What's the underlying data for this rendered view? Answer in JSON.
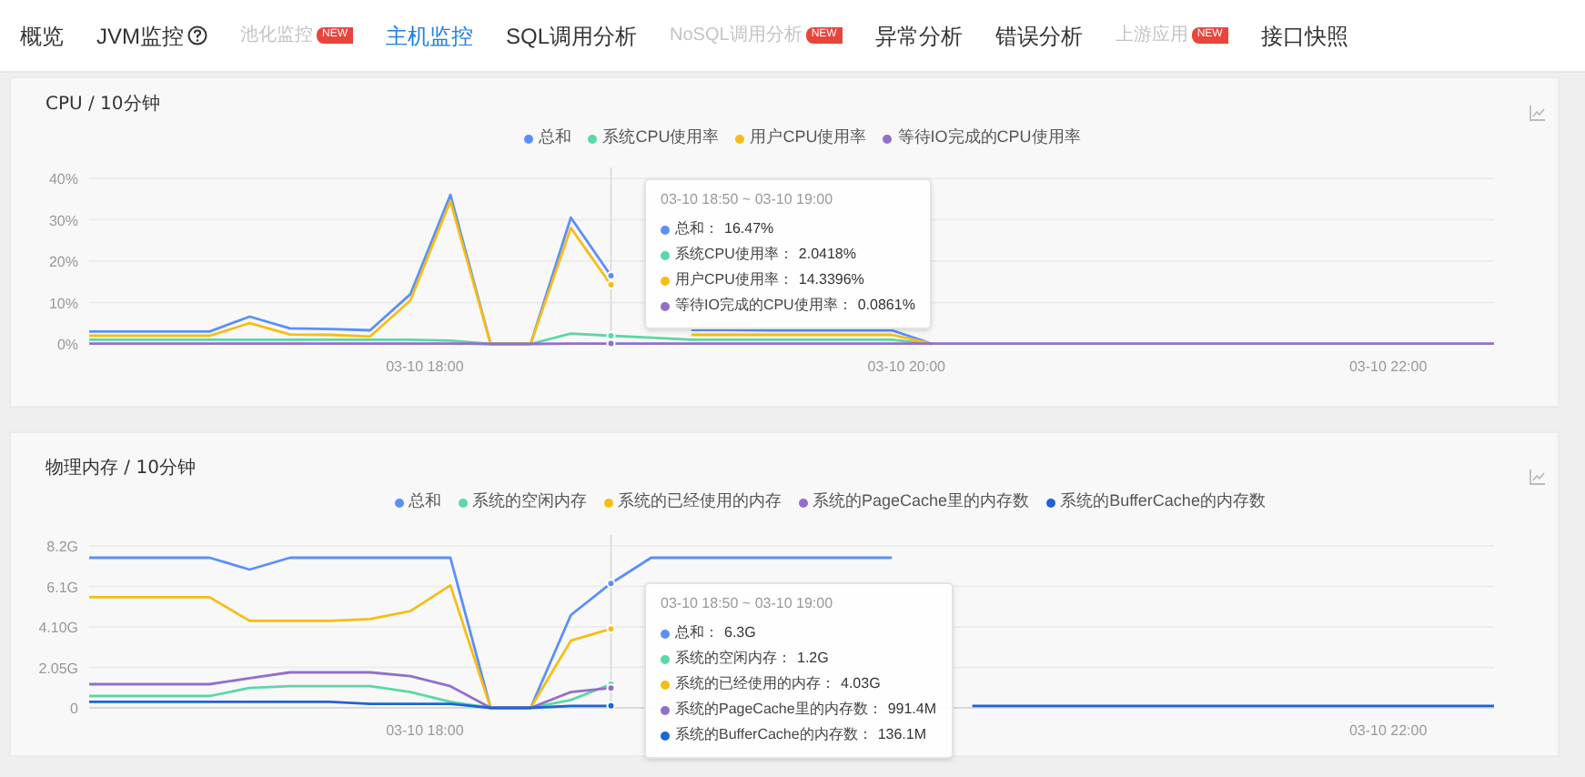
{
  "nav": [
    {
      "label": "概览",
      "kind": "plain",
      "selected": false,
      "disabled": false
    },
    {
      "label": "JVM监控",
      "kind": "help",
      "selected": false,
      "disabled": false
    },
    {
      "label": "池化监控",
      "kind": "badged",
      "badge": "NEW",
      "selected": false,
      "disabled": true
    },
    {
      "label": "主机监控",
      "kind": "plain",
      "selected": true,
      "disabled": false
    },
    {
      "label": "SQL调用分析",
      "kind": "plain",
      "selected": false,
      "disabled": false
    },
    {
      "label": "NoSQL调用分析",
      "kind": "badged",
      "badge": "NEW",
      "selected": false,
      "disabled": true
    },
    {
      "label": "异常分析",
      "kind": "plain",
      "selected": false,
      "disabled": false
    },
    {
      "label": "错误分析",
      "kind": "plain",
      "selected": false,
      "disabled": false
    },
    {
      "label": "上游应用",
      "kind": "badged",
      "badge": "NEW",
      "selected": false,
      "disabled": true
    },
    {
      "label": "接口快照",
      "kind": "plain",
      "selected": false,
      "disabled": false
    }
  ],
  "panels": [
    {
      "title": "CPU / 10分钟",
      "tooltip": {
        "title": "03-10 18:50 ~ 03-10 19:00",
        "items": [
          {
            "label": "总和：",
            "value": "16.47%",
            "color": "#5b8ff9"
          },
          {
            "label": "系统CPU使用率：",
            "value": "2.0418%",
            "color": "#5ad8a6"
          },
          {
            "label": "用户CPU使用率：",
            "value": "14.3396%",
            "color": "#f6bd16"
          },
          {
            "label": "等待IO完成的CPU使用率：",
            "value": "0.0861%",
            "color": "#9270ca"
          }
        ]
      },
      "chart_data": {
        "type": "line",
        "categories": [
          null,
          null,
          null,
          null,
          null,
          null,
          null,
          null,
          "03-10 18:00",
          null,
          null,
          null,
          null,
          null,
          null,
          null,
          null,
          null,
          null,
          null,
          "03-10 20:00",
          null,
          null,
          null,
          null,
          null,
          null,
          null,
          null,
          null,
          null,
          null,
          "03-10 22:00",
          null,
          null,
          null
        ],
        "series": [
          {
            "name": "总和",
            "color": "#5b8ff9",
            "values": [
              3,
              3,
              3,
              3,
              6.6,
              3.8,
              3.6,
              3.3,
              12,
              36,
              0,
              0,
              30.5,
              16.5,
              null,
              3.4,
              3.4,
              3.3,
              3.3,
              3.3,
              3.3,
              0,
              null,
              null,
              null,
              null,
              null,
              null,
              null,
              null,
              null,
              null,
              null,
              null,
              null,
              null
            ]
          },
          {
            "name": "系统CPU使用率",
            "color": "#5ad8a6",
            "values": [
              1,
              1,
              1,
              1,
              1,
              1,
              1,
              1,
              1,
              0.8,
              0,
              0,
              2.5,
              2,
              1.5,
              1,
              1,
              1,
              1,
              1,
              1,
              0,
              null,
              null,
              null,
              null,
              null,
              null,
              null,
              null,
              null,
              null,
              null,
              null,
              null,
              null
            ]
          },
          {
            "name": "用户CPU使用率",
            "color": "#f6bd16",
            "values": [
              2,
              2,
              2,
              2,
              5,
              2.3,
              2.2,
              1.8,
              10.5,
              34.5,
              0,
              0,
              28,
              14.3,
              null,
              2.2,
              2.2,
              2.2,
              2.2,
              2.2,
              2.2,
              0,
              null,
              null,
              null,
              null,
              null,
              null,
              null,
              null,
              null,
              null,
              null,
              null,
              null,
              null
            ]
          },
          {
            "name": "等待IO完成的CPU使用率",
            "color": "#9270ca",
            "values": [
              0.1,
              0.1,
              0.1,
              0.1,
              0.1,
              0.1,
              0.1,
              0.1,
              0.1,
              0.1,
              0,
              0,
              0.1,
              0.1,
              0.1,
              0.1,
              0.1,
              0.1,
              0.1,
              0.1,
              0.1,
              0.1,
              0.1,
              0.1,
              0.1,
              0.1,
              0.1,
              0.1,
              0.1,
              0.1,
              0.1,
              0.1,
              0.1,
              0.1,
              0.1,
              0.1
            ]
          }
        ],
        "ylim": [
          0,
          40
        ],
        "grid": true,
        "yticks": [
          {
            "value": 0,
            "label": "0%"
          },
          {
            "value": 10,
            "label": "10%"
          },
          {
            "value": 20,
            "label": "20%"
          },
          {
            "value": 30,
            "label": "30%"
          },
          {
            "value": 40,
            "label": "40%"
          }
        ]
      }
    },
    {
      "title": "物理内存 / 10分钟",
      "tooltip": {
        "title": "03-10 18:50 ~ 03-10 19:00",
        "items": [
          {
            "label": "总和：",
            "value": "6.3G",
            "color": "#5b8ff9"
          },
          {
            "label": "系统的空闲内存：",
            "value": "1.2G",
            "color": "#5ad8a6"
          },
          {
            "label": "系统的已经使用的内存：",
            "value": "4.03G",
            "color": "#f6bd16"
          },
          {
            "label": "系统的PageCache里的内存数：",
            "value": "991.4M",
            "color": "#9270ca"
          },
          {
            "label": "系统的BufferCache的内存数：",
            "value": "136.1M",
            "color": "#1e64d6"
          }
        ]
      },
      "chart_data": {
        "type": "line",
        "categories": [
          null,
          null,
          null,
          null,
          null,
          null,
          null,
          null,
          "03-10 18:00",
          null,
          null,
          null,
          null,
          null,
          null,
          null,
          null,
          null,
          null,
          null,
          null,
          null,
          null,
          null,
          null,
          null,
          null,
          null,
          null,
          null,
          null,
          null,
          "03-10 22:00",
          null,
          null,
          null
        ],
        "series": [
          {
            "name": "总和",
            "color": "#5b8ff9",
            "values": [
              7.6,
              7.6,
              7.6,
              7.6,
              7,
              7.6,
              7.6,
              7.6,
              7.6,
              7.6,
              0,
              0,
              4.7,
              6.3,
              7.6,
              7.6,
              7.6,
              7.6,
              7.6,
              7.6,
              7.6,
              null,
              null,
              null,
              null,
              null,
              null,
              null,
              null,
              null,
              null,
              null,
              null,
              null,
              null,
              null
            ]
          },
          {
            "name": "系统的空闲内存",
            "color": "#5ad8a6",
            "values": [
              0.6,
              0.6,
              0.6,
              0.6,
              1,
              1.1,
              1.1,
              1.1,
              0.8,
              0.3,
              0,
              0,
              0.4,
              1.2,
              null,
              null,
              null,
              null,
              null,
              null,
              null,
              null,
              null,
              null,
              null,
              null,
              null,
              null,
              null,
              null,
              null,
              null,
              null,
              null,
              null,
              null
            ]
          },
          {
            "name": "系统的已经使用的内存",
            "color": "#f6bd16",
            "values": [
              5.6,
              5.6,
              5.6,
              5.6,
              4.4,
              4.4,
              4.4,
              4.5,
              4.9,
              6.2,
              0,
              0,
              3.4,
              4,
              null,
              null,
              null,
              null,
              null,
              null,
              null,
              null,
              null,
              null,
              null,
              null,
              null,
              null,
              null,
              null,
              null,
              null,
              null,
              null,
              null,
              null
            ]
          },
          {
            "name": "系统的PageCache里的内存数",
            "color": "#9270ca",
            "values": [
              1.2,
              1.2,
              1.2,
              1.2,
              1.5,
              1.8,
              1.8,
              1.8,
              1.6,
              1.1,
              0,
              0,
              0.8,
              1,
              null,
              null,
              null,
              null,
              null,
              null,
              null,
              null,
              null,
              null,
              null,
              null,
              null,
              null,
              null,
              null,
              null,
              null,
              null,
              null,
              null,
              null
            ]
          },
          {
            "name": "系统的BufferCache的内存数",
            "color": "#1e64d6",
            "values": [
              0.3,
              0.3,
              0.3,
              0.3,
              0.3,
              0.3,
              0.3,
              0.2,
              0.2,
              0.2,
              0,
              0,
              0.1,
              0.1,
              null,
              null,
              null,
              null,
              null,
              null,
              null,
              null,
              0.1,
              0.1,
              0.1,
              0.1,
              0.1,
              0.1,
              0.1,
              0.1,
              0.1,
              0.1,
              0.1,
              0.1,
              0.1,
              0.1
            ]
          }
        ],
        "ylim": [
          0,
          8.2
        ],
        "grid": true,
        "yticks": [
          {
            "value": 0,
            "label": "0"
          },
          {
            "value": 2.05,
            "label": "2.05G"
          },
          {
            "value": 4.1,
            "label": "4.10G"
          },
          {
            "value": 6.15,
            "label": "6.1G"
          },
          {
            "value": 8.2,
            "label": "8.2G"
          }
        ]
      }
    }
  ]
}
